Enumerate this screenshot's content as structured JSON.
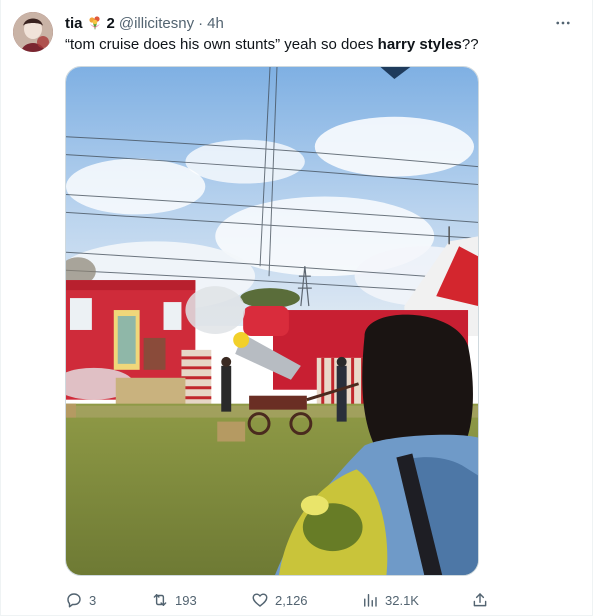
{
  "author": {
    "display_name": "tia",
    "name_suffix": "2",
    "handle": "@illicitesny",
    "separator": "·",
    "time": "4h"
  },
  "tweet": {
    "text_before": "“tom cruise does his own stunts” yeah so does ",
    "text_bold": "harry styles",
    "text_after": "??"
  },
  "actions": {
    "replies": "3",
    "retweets": "193",
    "likes": "2,126",
    "views": "32.1K"
  },
  "icons": {
    "more": "more-dots-icon",
    "reply": "reply-icon",
    "retweet": "retweet-icon",
    "like": "heart-icon",
    "views": "views-chart-icon",
    "share": "share-icon"
  },
  "colors": {
    "text_primary": "#0f1419",
    "text_secondary": "#536471",
    "border": "#cfd9de"
  }
}
